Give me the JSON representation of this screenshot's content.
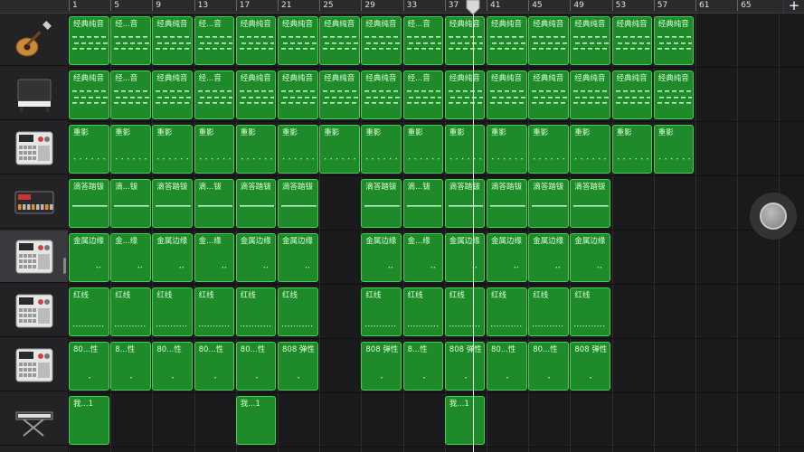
{
  "ruler": {
    "bars": [
      "1",
      "5",
      "9",
      "13",
      "17",
      "21",
      "25",
      "29",
      "33",
      "37",
      "41",
      "45",
      "49",
      "53",
      "57",
      "61",
      "65"
    ],
    "add_label": "+"
  },
  "colors": {
    "region_fill": "#1f8a2a",
    "region_border": "#45d04f",
    "region_text": "#d8ffd8",
    "background": "#1c1c1e"
  },
  "tracks": [
    {
      "name": "guitar-track",
      "icon": "acoustic-guitar-icon",
      "pattern": "chord",
      "regions": [
        {
          "bar": 1,
          "len": 4,
          "label": "经典纯音"
        },
        {
          "bar": 5,
          "len": 4,
          "label": "经...音"
        },
        {
          "bar": 9,
          "len": 4,
          "label": "经典纯音"
        },
        {
          "bar": 13,
          "len": 4,
          "label": "经...音"
        },
        {
          "bar": 17,
          "len": 4,
          "label": "经典纯音"
        },
        {
          "bar": 21,
          "len": 4,
          "label": "经典纯音"
        },
        {
          "bar": 25,
          "len": 4,
          "label": "经典纯音"
        },
        {
          "bar": 29,
          "len": 4,
          "label": "经典纯音"
        },
        {
          "bar": 33,
          "len": 4,
          "label": "经...音"
        },
        {
          "bar": 37,
          "len": 4,
          "label": "经典纯音"
        },
        {
          "bar": 41,
          "len": 4,
          "label": "经典纯音"
        },
        {
          "bar": 45,
          "len": 4,
          "label": "经典纯音"
        },
        {
          "bar": 49,
          "len": 4,
          "label": "经典纯音"
        },
        {
          "bar": 53,
          "len": 4,
          "label": "经典纯音"
        },
        {
          "bar": 57,
          "len": 4,
          "label": "经典纯音"
        }
      ]
    },
    {
      "name": "piano-track",
      "icon": "upright-piano-icon",
      "pattern": "chord",
      "regions": [
        {
          "bar": 1,
          "len": 4,
          "label": "经典纯音"
        },
        {
          "bar": 5,
          "len": 4,
          "label": "经...音"
        },
        {
          "bar": 9,
          "len": 4,
          "label": "经典纯音"
        },
        {
          "bar": 13,
          "len": 4,
          "label": "经...音"
        },
        {
          "bar": 17,
          "len": 4,
          "label": "经典纯音"
        },
        {
          "bar": 21,
          "len": 4,
          "label": "经典纯音"
        },
        {
          "bar": 25,
          "len": 4,
          "label": "经典纯音"
        },
        {
          "bar": 29,
          "len": 4,
          "label": "经典纯音"
        },
        {
          "bar": 33,
          "len": 4,
          "label": "经...音"
        },
        {
          "bar": 37,
          "len": 4,
          "label": "经典纯音"
        },
        {
          "bar": 41,
          "len": 4,
          "label": "经典纯音"
        },
        {
          "bar": 45,
          "len": 4,
          "label": "经典纯音"
        },
        {
          "bar": 49,
          "len": 4,
          "label": "经典纯音"
        },
        {
          "bar": 53,
          "len": 4,
          "label": "经典纯音"
        },
        {
          "bar": 57,
          "len": 4,
          "label": "经典纯音"
        }
      ]
    },
    {
      "name": "drum-machine-track-1",
      "icon": "drum-machine-icon",
      "pattern": "dots",
      "regions": [
        {
          "bar": 1,
          "len": 4,
          "label": "重影"
        },
        {
          "bar": 5,
          "len": 4,
          "label": "重影"
        },
        {
          "bar": 9,
          "len": 4,
          "label": "重影"
        },
        {
          "bar": 13,
          "len": 4,
          "label": "重影"
        },
        {
          "bar": 17,
          "len": 4,
          "label": "重影"
        },
        {
          "bar": 21,
          "len": 4,
          "label": "重影"
        },
        {
          "bar": 25,
          "len": 4,
          "label": "重影"
        },
        {
          "bar": 29,
          "len": 4,
          "label": "重影"
        },
        {
          "bar": 33,
          "len": 4,
          "label": "重影"
        },
        {
          "bar": 37,
          "len": 4,
          "label": "重影"
        },
        {
          "bar": 41,
          "len": 4,
          "label": "重影"
        },
        {
          "bar": 45,
          "len": 4,
          "label": "重影"
        },
        {
          "bar": 49,
          "len": 4,
          "label": "重影"
        },
        {
          "bar": 53,
          "len": 4,
          "label": "重影"
        },
        {
          "bar": 57,
          "len": 4,
          "label": "重影"
        }
      ]
    },
    {
      "name": "beat-sequencer-track",
      "icon": "beat-sequencer-icon",
      "pattern": "line",
      "regions": [
        {
          "bar": 1,
          "len": 4,
          "label": "滴答踏钹"
        },
        {
          "bar": 5,
          "len": 4,
          "label": "滴...钹"
        },
        {
          "bar": 9,
          "len": 4,
          "label": "滴答踏钹"
        },
        {
          "bar": 13,
          "len": 4,
          "label": "滴...钹"
        },
        {
          "bar": 17,
          "len": 4,
          "label": "滴答踏钹"
        },
        {
          "bar": 21,
          "len": 4,
          "label": "滴答踏钹"
        },
        {
          "bar": 29,
          "len": 4,
          "label": "滴答踏钹"
        },
        {
          "bar": 33,
          "len": 4,
          "label": "滴...钹"
        },
        {
          "bar": 37,
          "len": 4,
          "label": "滴答踏钹"
        },
        {
          "bar": 41,
          "len": 4,
          "label": "滴答踏钹"
        },
        {
          "bar": 45,
          "len": 4,
          "label": "滴答踏钹"
        },
        {
          "bar": 49,
          "len": 4,
          "label": "滴答踏钹"
        }
      ]
    },
    {
      "name": "drum-machine-track-2",
      "icon": "drum-machine-icon",
      "pattern": "sparse",
      "regions": [
        {
          "bar": 1,
          "len": 4,
          "label": "金属边缘"
        },
        {
          "bar": 5,
          "len": 4,
          "label": "金...缘"
        },
        {
          "bar": 9,
          "len": 4,
          "label": "金属边缘"
        },
        {
          "bar": 13,
          "len": 4,
          "label": "金...缘"
        },
        {
          "bar": 17,
          "len": 4,
          "label": "金属边缘"
        },
        {
          "bar": 21,
          "len": 4,
          "label": "金属边缘"
        },
        {
          "bar": 29,
          "len": 4,
          "label": "金属边缘"
        },
        {
          "bar": 33,
          "len": 4,
          "label": "金...缘"
        },
        {
          "bar": 37,
          "len": 4,
          "label": "金属边缘"
        },
        {
          "bar": 41,
          "len": 4,
          "label": "金属边缘"
        },
        {
          "bar": 45,
          "len": 4,
          "label": "金属边缘"
        },
        {
          "bar": 49,
          "len": 4,
          "label": "金属边缘"
        }
      ]
    },
    {
      "name": "drum-machine-track-3",
      "icon": "drum-machine-icon",
      "pattern": "dense",
      "regions": [
        {
          "bar": 1,
          "len": 4,
          "label": "红线"
        },
        {
          "bar": 5,
          "len": 4,
          "label": "红线"
        },
        {
          "bar": 9,
          "len": 4,
          "label": "红线"
        },
        {
          "bar": 13,
          "len": 4,
          "label": "红线"
        },
        {
          "bar": 17,
          "len": 4,
          "label": "红线"
        },
        {
          "bar": 21,
          "len": 4,
          "label": "红线"
        },
        {
          "bar": 29,
          "len": 4,
          "label": "红线"
        },
        {
          "bar": 33,
          "len": 4,
          "label": "红线"
        },
        {
          "bar": 37,
          "len": 4,
          "label": "红线"
        },
        {
          "bar": 41,
          "len": 4,
          "label": "红线"
        },
        {
          "bar": 45,
          "len": 4,
          "label": "红线"
        },
        {
          "bar": 49,
          "len": 4,
          "label": "红线"
        }
      ]
    },
    {
      "name": "drum-machine-track-4",
      "icon": "drum-machine-icon",
      "pattern": "single",
      "regions": [
        {
          "bar": 1,
          "len": 4,
          "label": "80...性"
        },
        {
          "bar": 5,
          "len": 4,
          "label": "8...性"
        },
        {
          "bar": 9,
          "len": 4,
          "label": "80...性"
        },
        {
          "bar": 13,
          "len": 4,
          "label": "80...性"
        },
        {
          "bar": 17,
          "len": 4,
          "label": "80...性"
        },
        {
          "bar": 21,
          "len": 4,
          "label": "808 弹性"
        },
        {
          "bar": 29,
          "len": 4,
          "label": "808 弹性"
        },
        {
          "bar": 33,
          "len": 4,
          "label": "8...性"
        },
        {
          "bar": 37,
          "len": 4,
          "label": "808 弹性"
        },
        {
          "bar": 41,
          "len": 4,
          "label": "80...性"
        },
        {
          "bar": 45,
          "len": 4,
          "label": "80...性"
        },
        {
          "bar": 49,
          "len": 4,
          "label": "808 弹性"
        }
      ]
    },
    {
      "name": "keyboard-track",
      "icon": "keyboard-stand-icon",
      "pattern": "none",
      "regions": [
        {
          "bar": 1,
          "len": 4,
          "label": "我...1"
        },
        {
          "bar": 17,
          "len": 4,
          "label": "我...1"
        },
        {
          "bar": 37,
          "len": 4,
          "label": "我...1"
        }
      ]
    }
  ]
}
